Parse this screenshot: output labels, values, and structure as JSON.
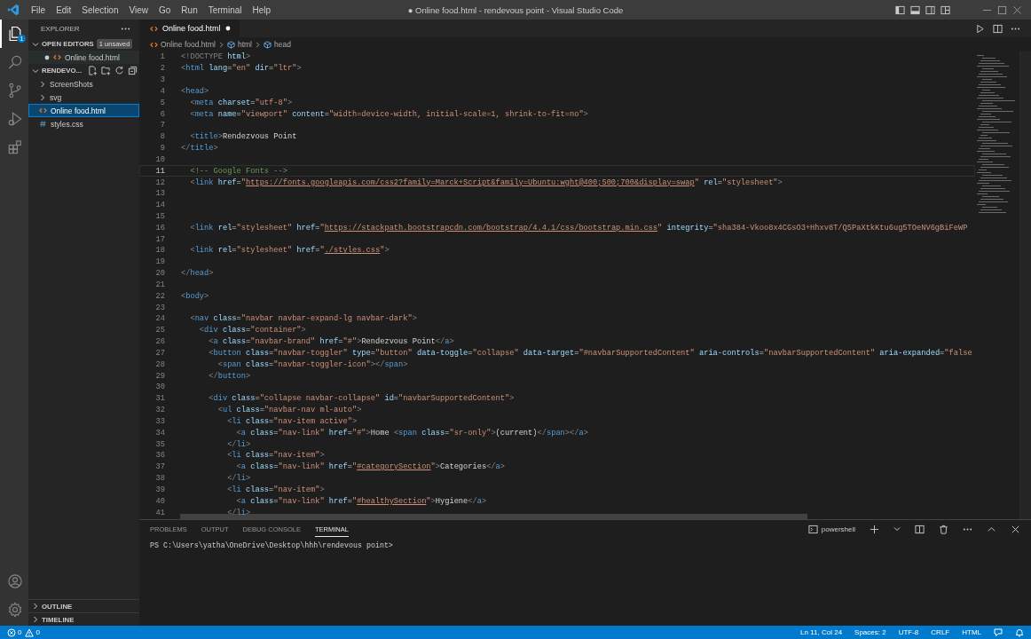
{
  "window": {
    "title": "● Online food.html - rendevous point - Visual Studio Code"
  },
  "menu": [
    "File",
    "Edit",
    "Selection",
    "View",
    "Go",
    "Run",
    "Terminal",
    "Help"
  ],
  "activity_bar": [
    {
      "kind": "files",
      "selected": true,
      "badge": "1"
    },
    {
      "kind": "search",
      "selected": false
    },
    {
      "kind": "source-control",
      "selected": false
    },
    {
      "kind": "run",
      "selected": false
    },
    {
      "kind": "extensions",
      "selected": false
    }
  ],
  "activity_bar_bottom": [
    {
      "kind": "account"
    },
    {
      "kind": "settings"
    }
  ],
  "sidebar": {
    "title": "EXPLORER",
    "open_editors": {
      "label": "OPEN EDITORS",
      "expanded": true,
      "badge": "1 unsaved",
      "items": [
        {
          "label": "Online food.html",
          "kind": "html",
          "modified": true
        }
      ]
    },
    "folder": {
      "label": "RENDEVO...",
      "expanded": true,
      "items": [
        {
          "label": "ScreenShots",
          "kind": "folder",
          "expanded": false,
          "selected": false
        },
        {
          "label": "svg",
          "kind": "folder",
          "expanded": false,
          "selected": false
        },
        {
          "label": "Online food.html",
          "kind": "html",
          "selected": true
        },
        {
          "label": "styles.css",
          "kind": "css",
          "selected": false
        }
      ]
    },
    "bottom_sections": [
      {
        "label": "OUTLINE",
        "expanded": false
      },
      {
        "label": "TIMELINE",
        "expanded": false
      }
    ]
  },
  "editor": {
    "tabs": [
      {
        "label": "Online food.html",
        "kind": "html",
        "selected": true,
        "modified": true
      }
    ],
    "breadcrumbs": [
      {
        "label": "Online food.html",
        "kind": "html"
      },
      {
        "label": "html",
        "kind": "element"
      },
      {
        "label": "head",
        "kind": "element"
      }
    ],
    "lines": [
      {
        "number": "1",
        "current": false,
        "tokens": [
          {
            "text": "<!DOCTYPE ",
            "kind": "p"
          },
          {
            "text": "html",
            "kind": "at"
          },
          {
            "text": ">",
            "kind": "p"
          }
        ]
      },
      {
        "number": "2",
        "current": false,
        "tokens": [
          {
            "text": "<",
            "kind": "p"
          },
          {
            "text": "html",
            "kind": "tg"
          },
          {
            "text": " lang",
            "kind": "at"
          },
          {
            "text": "=",
            "kind": "x"
          },
          {
            "text": "\"en\"",
            "kind": "s"
          },
          {
            "text": " dir",
            "kind": "at"
          },
          {
            "text": "=",
            "kind": "x"
          },
          {
            "text": "\"ltr\"",
            "kind": "s"
          },
          {
            "text": ">",
            "kind": "p"
          }
        ]
      },
      {
        "number": "3",
        "current": false
      },
      {
        "number": "4",
        "current": false,
        "tokens": [
          {
            "text": "<",
            "kind": "p"
          },
          {
            "text": "head",
            "kind": "tg"
          },
          {
            "text": ">",
            "kind": "p"
          }
        ]
      },
      {
        "number": "5",
        "current": false,
        "tokens": [
          {
            "text": "  <",
            "kind": "p"
          },
          {
            "text": "meta",
            "kind": "tg"
          },
          {
            "text": " charset",
            "kind": "at"
          },
          {
            "text": "=",
            "kind": "x"
          },
          {
            "text": "\"utf-8\"",
            "kind": "s"
          },
          {
            "text": ">",
            "kind": "p"
          }
        ]
      },
      {
        "number": "6",
        "current": false,
        "tokens": [
          {
            "text": "  <",
            "kind": "p"
          },
          {
            "text": "meta",
            "kind": "tg"
          },
          {
            "text": " name",
            "kind": "at"
          },
          {
            "text": "=",
            "kind": "x"
          },
          {
            "text": "\"viewport\"",
            "kind": "s"
          },
          {
            "text": " content",
            "kind": "at"
          },
          {
            "text": "=",
            "kind": "x"
          },
          {
            "text": "\"width=device-width, initial-scale=1, shrink-to-fit=no\"",
            "kind": "s"
          },
          {
            "text": ">",
            "kind": "p"
          }
        ]
      },
      {
        "number": "7",
        "current": false
      },
      {
        "number": "8",
        "current": false,
        "tokens": [
          {
            "text": "  <",
            "kind": "p"
          },
          {
            "text": "title",
            "kind": "tg"
          },
          {
            "text": ">",
            "kind": "p"
          },
          {
            "text": "Rendezvous Point",
            "kind": "x"
          }
        ]
      },
      {
        "number": "9",
        "current": false,
        "tokens": [
          {
            "text": "</",
            "kind": "p"
          },
          {
            "text": "title",
            "kind": "tg"
          },
          {
            "text": ">",
            "kind": "p"
          }
        ]
      },
      {
        "number": "10",
        "current": false
      },
      {
        "number": "11",
        "current": true,
        "tokens": [
          {
            "text": "  <!-- Google Fonts -->",
            "kind": "c"
          }
        ]
      },
      {
        "number": "12",
        "current": false,
        "tokens": [
          {
            "text": "  <",
            "kind": "p"
          },
          {
            "text": "link",
            "kind": "tg"
          },
          {
            "text": " href",
            "kind": "at"
          },
          {
            "text": "=",
            "kind": "x"
          },
          {
            "text": "\"",
            "kind": "s"
          },
          {
            "text": "https://fonts.googleapis.com/css2?family=Marck+Script&family=Ubuntu:wght@400;500;700&display=swap",
            "kind": "u"
          },
          {
            "text": "\"",
            "kind": "s"
          },
          {
            "text": " rel",
            "kind": "at"
          },
          {
            "text": "=",
            "kind": "x"
          },
          {
            "text": "\"stylesheet\"",
            "kind": "s"
          },
          {
            "text": ">",
            "kind": "p"
          }
        ]
      },
      {
        "number": "13",
        "current": false
      },
      {
        "number": "14",
        "current": false
      },
      {
        "number": "15",
        "current": false
      },
      {
        "number": "16",
        "current": false,
        "tokens": [
          {
            "text": "  <",
            "kind": "p"
          },
          {
            "text": "link",
            "kind": "tg"
          },
          {
            "text": " rel",
            "kind": "at"
          },
          {
            "text": "=",
            "kind": "x"
          },
          {
            "text": "\"stylesheet\"",
            "kind": "s"
          },
          {
            "text": " href",
            "kind": "at"
          },
          {
            "text": "=",
            "kind": "x"
          },
          {
            "text": "\"",
            "kind": "s"
          },
          {
            "text": "https://stackpath.bootstrapcdn.com/bootstrap/4.4.1/css/bootstrap.min.css",
            "kind": "u"
          },
          {
            "text": "\"",
            "kind": "s"
          },
          {
            "text": " integrity",
            "kind": "at"
          },
          {
            "text": "=",
            "kind": "x"
          },
          {
            "text": "\"sha384-Vkoo8x4CGsO3+Hhxv8T/Q5PaXtkKtu6ug5TOeNV6gBiFeWP",
            "kind": "s"
          }
        ]
      },
      {
        "number": "17",
        "current": false
      },
      {
        "number": "18",
        "current": false,
        "tokens": [
          {
            "text": "  <",
            "kind": "p"
          },
          {
            "text": "link",
            "kind": "tg"
          },
          {
            "text": " rel",
            "kind": "at"
          },
          {
            "text": "=",
            "kind": "x"
          },
          {
            "text": "\"stylesheet\"",
            "kind": "s"
          },
          {
            "text": " href",
            "kind": "at"
          },
          {
            "text": "=",
            "kind": "x"
          },
          {
            "text": "\"",
            "kind": "s"
          },
          {
            "text": "./styles.css",
            "kind": "u"
          },
          {
            "text": "\"",
            "kind": "s"
          },
          {
            "text": ">",
            "kind": "p"
          }
        ]
      },
      {
        "number": "19",
        "current": false
      },
      {
        "number": "20",
        "current": false,
        "tokens": [
          {
            "text": "</",
            "kind": "p"
          },
          {
            "text": "head",
            "kind": "tg"
          },
          {
            "text": ">",
            "kind": "p"
          }
        ]
      },
      {
        "number": "21",
        "current": false
      },
      {
        "number": "22",
        "current": false,
        "tokens": [
          {
            "text": "<",
            "kind": "p"
          },
          {
            "text": "body",
            "kind": "tg"
          },
          {
            "text": ">",
            "kind": "p"
          }
        ]
      },
      {
        "number": "23",
        "current": false
      },
      {
        "number": "24",
        "current": false,
        "tokens": [
          {
            "text": "  <",
            "kind": "p"
          },
          {
            "text": "nav",
            "kind": "tg"
          },
          {
            "text": " class",
            "kind": "at"
          },
          {
            "text": "=",
            "kind": "x"
          },
          {
            "text": "\"navbar navbar-expand-lg navbar-dark\"",
            "kind": "s"
          },
          {
            "text": ">",
            "kind": "p"
          }
        ]
      },
      {
        "number": "25",
        "current": false,
        "tokens": [
          {
            "text": "    <",
            "kind": "p"
          },
          {
            "text": "div",
            "kind": "tg"
          },
          {
            "text": " class",
            "kind": "at"
          },
          {
            "text": "=",
            "kind": "x"
          },
          {
            "text": "\"container\"",
            "kind": "s"
          },
          {
            "text": ">",
            "kind": "p"
          }
        ]
      },
      {
        "number": "26",
        "current": false,
        "tokens": [
          {
            "text": "      <",
            "kind": "p"
          },
          {
            "text": "a",
            "kind": "tg"
          },
          {
            "text": " class",
            "kind": "at"
          },
          {
            "text": "=",
            "kind": "x"
          },
          {
            "text": "\"navbar-brand\"",
            "kind": "s"
          },
          {
            "text": " href",
            "kind": "at"
          },
          {
            "text": "=",
            "kind": "x"
          },
          {
            "text": "\"#\"",
            "kind": "s"
          },
          {
            "text": ">",
            "kind": "p"
          },
          {
            "text": "Rendezvous Point",
            "kind": "x"
          },
          {
            "text": "</",
            "kind": "p"
          },
          {
            "text": "a",
            "kind": "tg"
          },
          {
            "text": ">",
            "kind": "p"
          }
        ]
      },
      {
        "number": "27",
        "current": false,
        "tokens": [
          {
            "text": "      <",
            "kind": "p"
          },
          {
            "text": "button",
            "kind": "tg"
          },
          {
            "text": " class",
            "kind": "at"
          },
          {
            "text": "=",
            "kind": "x"
          },
          {
            "text": "\"navbar-toggler\"",
            "kind": "s"
          },
          {
            "text": " type",
            "kind": "at"
          },
          {
            "text": "=",
            "kind": "x"
          },
          {
            "text": "\"button\"",
            "kind": "s"
          },
          {
            "text": " data-toggle",
            "kind": "at"
          },
          {
            "text": "=",
            "kind": "x"
          },
          {
            "text": "\"collapse\"",
            "kind": "s"
          },
          {
            "text": " data-target",
            "kind": "at"
          },
          {
            "text": "=",
            "kind": "x"
          },
          {
            "text": "\"#navbarSupportedContent\"",
            "kind": "s"
          },
          {
            "text": " aria-controls",
            "kind": "at"
          },
          {
            "text": "=",
            "kind": "x"
          },
          {
            "text": "\"navbarSupportedContent\"",
            "kind": "s"
          },
          {
            "text": " aria-expanded",
            "kind": "at"
          },
          {
            "text": "=",
            "kind": "x"
          },
          {
            "text": "\"false",
            "kind": "s"
          }
        ]
      },
      {
        "number": "28",
        "current": false,
        "tokens": [
          {
            "text": "        <",
            "kind": "p"
          },
          {
            "text": "span",
            "kind": "tg"
          },
          {
            "text": " class",
            "kind": "at"
          },
          {
            "text": "=",
            "kind": "x"
          },
          {
            "text": "\"navbar-toggler-icon\"",
            "kind": "s"
          },
          {
            "text": "></",
            "kind": "p"
          },
          {
            "text": "span",
            "kind": "tg"
          },
          {
            "text": ">",
            "kind": "p"
          }
        ]
      },
      {
        "number": "29",
        "current": false,
        "tokens": [
          {
            "text": "      </",
            "kind": "p"
          },
          {
            "text": "button",
            "kind": "tg"
          },
          {
            "text": ">",
            "kind": "p"
          }
        ]
      },
      {
        "number": "30",
        "current": false
      },
      {
        "number": "31",
        "current": false,
        "tokens": [
          {
            "text": "      <",
            "kind": "p"
          },
          {
            "text": "div",
            "kind": "tg"
          },
          {
            "text": " class",
            "kind": "at"
          },
          {
            "text": "=",
            "kind": "x"
          },
          {
            "text": "\"collapse navbar-collapse\"",
            "kind": "s"
          },
          {
            "text": " id",
            "kind": "at"
          },
          {
            "text": "=",
            "kind": "x"
          },
          {
            "text": "\"navbarSupportedContent\"",
            "kind": "s"
          },
          {
            "text": ">",
            "kind": "p"
          }
        ]
      },
      {
        "number": "32",
        "current": false,
        "tokens": [
          {
            "text": "        <",
            "kind": "p"
          },
          {
            "text": "ul",
            "kind": "tg"
          },
          {
            "text": " class",
            "kind": "at"
          },
          {
            "text": "=",
            "kind": "x"
          },
          {
            "text": "\"navbar-nav ml-auto\"",
            "kind": "s"
          },
          {
            "text": ">",
            "kind": "p"
          }
        ]
      },
      {
        "number": "33",
        "current": false,
        "tokens": [
          {
            "text": "          <",
            "kind": "p"
          },
          {
            "text": "li",
            "kind": "tg"
          },
          {
            "text": " class",
            "kind": "at"
          },
          {
            "text": "=",
            "kind": "x"
          },
          {
            "text": "\"nav-item active\"",
            "kind": "s"
          },
          {
            "text": ">",
            "kind": "p"
          }
        ]
      },
      {
        "number": "34",
        "current": false,
        "tokens": [
          {
            "text": "            <",
            "kind": "p"
          },
          {
            "text": "a",
            "kind": "tg"
          },
          {
            "text": " class",
            "kind": "at"
          },
          {
            "text": "=",
            "kind": "x"
          },
          {
            "text": "\"nav-link\"",
            "kind": "s"
          },
          {
            "text": " href",
            "kind": "at"
          },
          {
            "text": "=",
            "kind": "x"
          },
          {
            "text": "\"#\"",
            "kind": "s"
          },
          {
            "text": ">",
            "kind": "p"
          },
          {
            "text": "Home ",
            "kind": "x"
          },
          {
            "text": "<",
            "kind": "p"
          },
          {
            "text": "span",
            "kind": "tg"
          },
          {
            "text": " class",
            "kind": "at"
          },
          {
            "text": "=",
            "kind": "x"
          },
          {
            "text": "\"sr-only\"",
            "kind": "s"
          },
          {
            "text": ">",
            "kind": "p"
          },
          {
            "text": "(current)",
            "kind": "x"
          },
          {
            "text": "</",
            "kind": "p"
          },
          {
            "text": "span",
            "kind": "tg"
          },
          {
            "text": "></",
            "kind": "p"
          },
          {
            "text": "a",
            "kind": "tg"
          },
          {
            "text": ">",
            "kind": "p"
          }
        ]
      },
      {
        "number": "35",
        "current": false,
        "tokens": [
          {
            "text": "          </",
            "kind": "p"
          },
          {
            "text": "li",
            "kind": "tg"
          },
          {
            "text": ">",
            "kind": "p"
          }
        ]
      },
      {
        "number": "36",
        "current": false,
        "tokens": [
          {
            "text": "          <",
            "kind": "p"
          },
          {
            "text": "li",
            "kind": "tg"
          },
          {
            "text": " class",
            "kind": "at"
          },
          {
            "text": "=",
            "kind": "x"
          },
          {
            "text": "\"nav-item\"",
            "kind": "s"
          },
          {
            "text": ">",
            "kind": "p"
          }
        ]
      },
      {
        "number": "37",
        "current": false,
        "tokens": [
          {
            "text": "            <",
            "kind": "p"
          },
          {
            "text": "a",
            "kind": "tg"
          },
          {
            "text": " class",
            "kind": "at"
          },
          {
            "text": "=",
            "kind": "x"
          },
          {
            "text": "\"nav-link\"",
            "kind": "s"
          },
          {
            "text": " href",
            "kind": "at"
          },
          {
            "text": "=",
            "kind": "x"
          },
          {
            "text": "\"",
            "kind": "s"
          },
          {
            "text": "#categorySection",
            "kind": "u"
          },
          {
            "text": "\"",
            "kind": "s"
          },
          {
            "text": ">",
            "kind": "p"
          },
          {
            "text": "Categories",
            "kind": "x"
          },
          {
            "text": "</",
            "kind": "p"
          },
          {
            "text": "a",
            "kind": "tg"
          },
          {
            "text": ">",
            "kind": "p"
          }
        ]
      },
      {
        "number": "38",
        "current": false,
        "tokens": [
          {
            "text": "          </",
            "kind": "p"
          },
          {
            "text": "li",
            "kind": "tg"
          },
          {
            "text": ">",
            "kind": "p"
          }
        ]
      },
      {
        "number": "39",
        "current": false,
        "tokens": [
          {
            "text": "          <",
            "kind": "p"
          },
          {
            "text": "li",
            "kind": "tg"
          },
          {
            "text": " class",
            "kind": "at"
          },
          {
            "text": "=",
            "kind": "x"
          },
          {
            "text": "\"nav-item\"",
            "kind": "s"
          },
          {
            "text": ">",
            "kind": "p"
          }
        ]
      },
      {
        "number": "40",
        "current": false,
        "tokens": [
          {
            "text": "            <",
            "kind": "p"
          },
          {
            "text": "a",
            "kind": "tg"
          },
          {
            "text": " class",
            "kind": "at"
          },
          {
            "text": "=",
            "kind": "x"
          },
          {
            "text": "\"nav-link\"",
            "kind": "s"
          },
          {
            "text": " href",
            "kind": "at"
          },
          {
            "text": "=",
            "kind": "x"
          },
          {
            "text": "\"",
            "kind": "s"
          },
          {
            "text": "#healthySection",
            "kind": "u"
          },
          {
            "text": "\"",
            "kind": "s"
          },
          {
            "text": ">",
            "kind": "p"
          },
          {
            "text": "Hygiene",
            "kind": "x"
          },
          {
            "text": "</",
            "kind": "p"
          },
          {
            "text": "a",
            "kind": "tg"
          },
          {
            "text": ">",
            "kind": "p"
          }
        ]
      },
      {
        "number": "41",
        "current": false,
        "tokens": [
          {
            "text": "          </",
            "kind": "p"
          },
          {
            "text": "li",
            "kind": "tg"
          },
          {
            "text": ">",
            "kind": "p"
          }
        ]
      }
    ]
  },
  "panel": {
    "tabs": [
      {
        "label": "PROBLEMS",
        "selected": false
      },
      {
        "label": "OUTPUT",
        "selected": false
      },
      {
        "label": "DEBUG CONSOLE",
        "selected": false
      },
      {
        "label": "TERMINAL",
        "selected": true
      }
    ],
    "shell": "powershell",
    "terminal_lines": [
      "PS C:\\Users\\yatha\\OneDrive\\Desktop\\hhh\\rendevous point>"
    ]
  },
  "status_bar": {
    "left": [
      {
        "kind": "errors",
        "count": "0"
      },
      {
        "kind": "warnings",
        "count": "0"
      }
    ],
    "right": [
      "Ln 11, Col 24",
      "Spaces: 2",
      "UTF-8",
      "CRLF",
      "HTML"
    ]
  }
}
